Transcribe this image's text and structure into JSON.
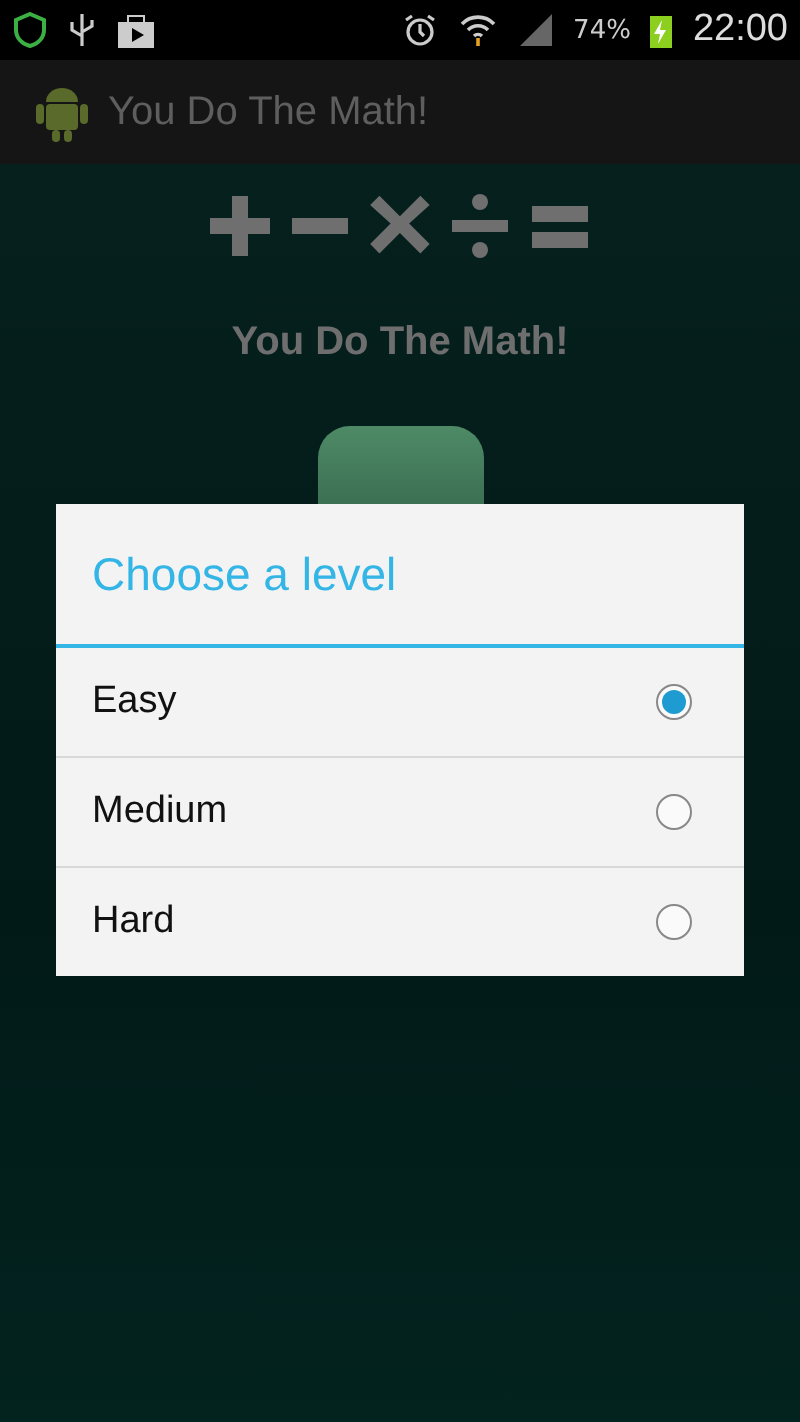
{
  "status_bar": {
    "battery": "74%",
    "time": "22:00"
  },
  "action_bar": {
    "title": "You Do The Math!"
  },
  "main": {
    "heading": "You Do The Math!"
  },
  "dialog": {
    "title": "Choose a level",
    "options": [
      {
        "label": "Easy",
        "selected": true
      },
      {
        "label": "Medium",
        "selected": false
      },
      {
        "label": "Hard",
        "selected": false
      }
    ]
  }
}
